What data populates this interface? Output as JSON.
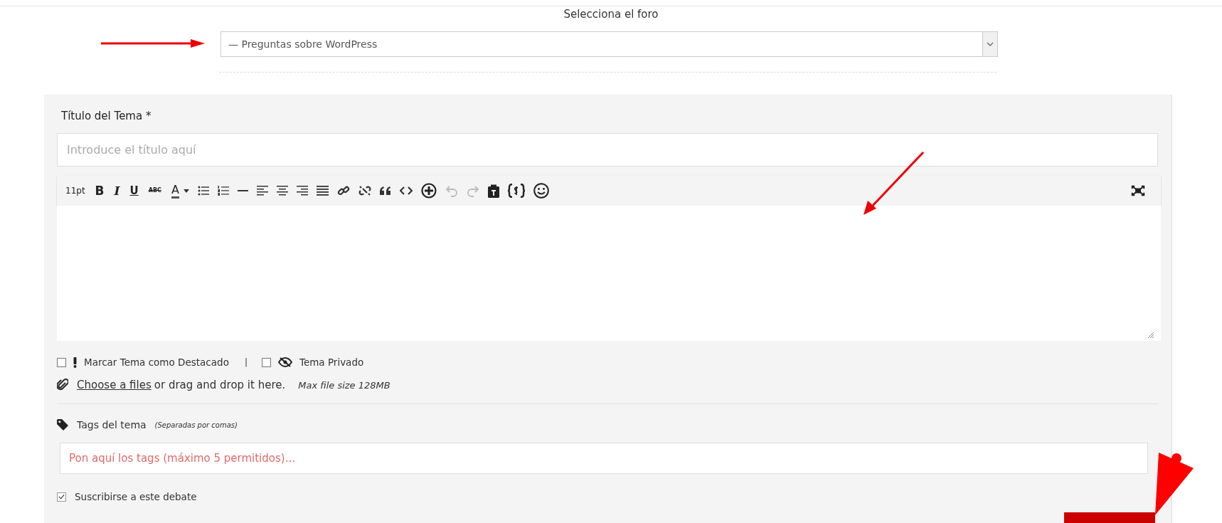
{
  "forum_select": {
    "label": "Selecciona el foro",
    "value": "— Preguntas sobre WordPress"
  },
  "topic_title": {
    "label": "Título del Tema *",
    "placeholder": "Introduce el título aquí"
  },
  "toolbar": {
    "font_size": "11pt",
    "text_buttons": [
      "B",
      "I",
      "U",
      "ABC",
      "A"
    ],
    "undo_disabled": true,
    "redo_disabled": true
  },
  "options": [
    {
      "label": "Marcar Tema como Destacado",
      "checked": false,
      "kind": "featured"
    },
    {
      "label": "Tema Privado",
      "checked": false,
      "kind": "private"
    }
  ],
  "options_separator": "|",
  "attachment": {
    "link": "Choose a files",
    "text": "or drag and drop it here.",
    "max_size": "Max file size 128MB"
  },
  "tags": {
    "label": "Tags del tema",
    "hint": "(Separadas por comas)",
    "placeholder": "Pon aquí los tags (máximo 5 permitidos)..."
  },
  "subscribe": {
    "label": "Suscribirse a este debate",
    "checked": true
  }
}
